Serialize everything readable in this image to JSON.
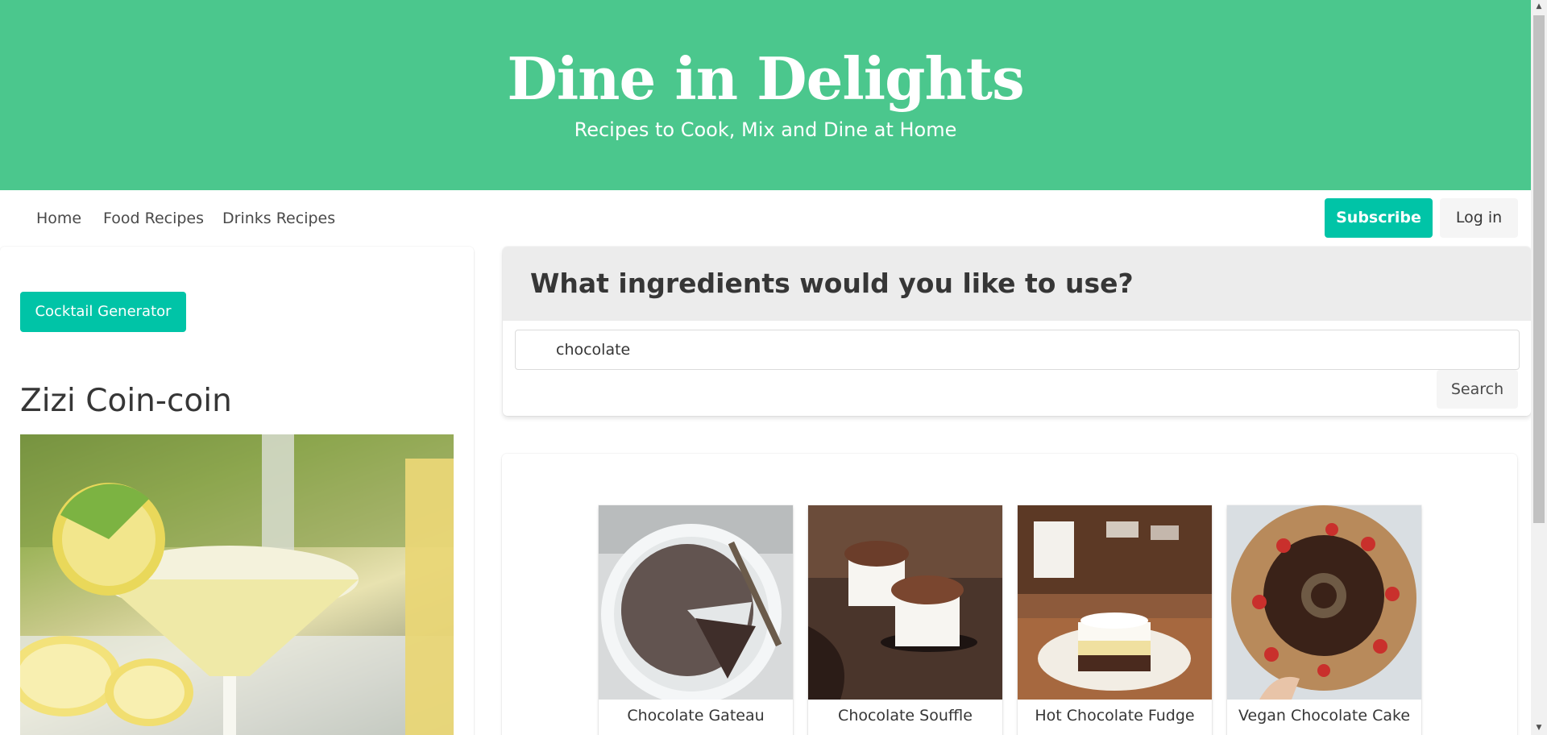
{
  "hero": {
    "title": "Dine in Delights",
    "subtitle": "Recipes to Cook, Mix and Dine at Home"
  },
  "nav": {
    "items": [
      {
        "label": "Home"
      },
      {
        "label": "Food Recipes"
      },
      {
        "label": "Drinks Recipes"
      }
    ],
    "subscribe_label": "Subscribe",
    "login_label": "Log in"
  },
  "sidebar": {
    "cocktail_button_label": "Cocktail Generator",
    "cocktail_name": "Zizi Coin-coin"
  },
  "search": {
    "question": "What ingredients would you like to use?",
    "input_value": "chocolate",
    "button_label": "Search"
  },
  "results": [
    {
      "name": "Chocolate Gateau"
    },
    {
      "name": "Chocolate Souffle"
    },
    {
      "name": "Hot Chocolate Fudge"
    },
    {
      "name": "Vegan Chocolate Cake"
    }
  ],
  "colors": {
    "hero_bg": "#4bc78d",
    "primary_button": "#00c4a7",
    "light_button": "#f5f5f5"
  }
}
